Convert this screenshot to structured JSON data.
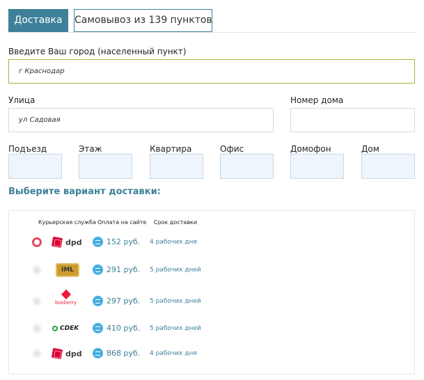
{
  "tabs": {
    "delivery": "Доставка",
    "pickup": "Самовывоз из 139 пунктов"
  },
  "city": {
    "label": "Введите Ваш город (населенный пункт)",
    "value": "г Краснодар"
  },
  "street": {
    "label": "Улица",
    "value": "ул Садовая"
  },
  "house_number": {
    "label": "Номер дома",
    "value": ""
  },
  "extra_fields": [
    "Подъезд",
    "Этаж",
    "Квартира",
    "Офис",
    "Домофон",
    "Дом"
  ],
  "delivery_heading": "Выберите вариант доставки:",
  "columns": {
    "courier": "Курьерская служба",
    "payment": "Оплата на сайте",
    "term": "Срок доставки"
  },
  "options": [
    {
      "service": "dpd",
      "price": "152 руб.",
      "term": "4 рабочих дня",
      "selected": true
    },
    {
      "service": "IML",
      "price": "291 руб.",
      "term": "5 рабочих дней",
      "selected": false
    },
    {
      "service": "boxberry",
      "price": "297 руб.",
      "term": "5 рабочих дней",
      "selected": false
    },
    {
      "service": "CDEK",
      "price": "410 руб.",
      "term": "5 рабочих дней",
      "selected": false
    },
    {
      "service": "dpd",
      "price": "868 руб.",
      "term": "4 рабочих дня",
      "selected": false
    }
  ],
  "colors": {
    "accent": "#3e8099",
    "selected_radio": "#e34b5c",
    "city_border": "#9abb3c",
    "pay_icon": "#45aee0"
  }
}
